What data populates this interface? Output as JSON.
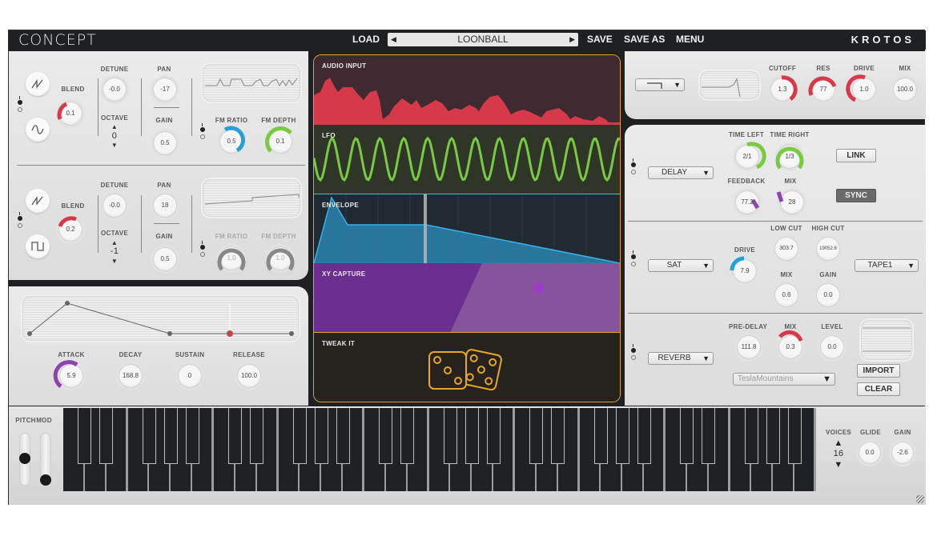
{
  "header": {
    "logo": "CONCEPT",
    "load": "LOAD",
    "preset": "LOONBALL",
    "save": "SAVE",
    "save_as": "SAVE AS",
    "menu": "MENU",
    "brand": "KROTOS",
    "prev_icon": "◀",
    "next_icon": "▶"
  },
  "osc1": {
    "blend_label": "BLEND",
    "blend": "0.1",
    "detune_label": "DETUNE",
    "detune": "-0.0",
    "octave_label": "OCTAVE",
    "octave": "0",
    "pan_label": "PAN",
    "pan": "-17",
    "gain_label": "GAIN",
    "gain": "0.5",
    "fm_ratio_label": "FM RATIO",
    "fm_ratio": "0.5",
    "fm_depth_label": "FM DEPTH",
    "fm_depth": "0.1",
    "wave_top": "saw",
    "wave_bottom": "sine"
  },
  "osc2": {
    "blend_label": "BLEND",
    "blend": "0.2",
    "detune_label": "DETUNE",
    "detune": "-0.0",
    "octave_label": "OCTAVE",
    "octave": "-1",
    "pan_label": "PAN",
    "pan": "18",
    "gain_label": "GAIN",
    "gain": "0.5",
    "fm_ratio_label": "FM RATIO",
    "fm_ratio": "1.0",
    "fm_depth_label": "FM DEPTH",
    "fm_depth": "1.0",
    "wave_top": "saw",
    "wave_bottom": "square"
  },
  "env": {
    "attack_label": "ATTACK",
    "attack": "5.9",
    "decay_label": "DECAY",
    "decay": "168.8",
    "sustain_label": "SUSTAIN",
    "sustain": "0",
    "release_label": "RELEASE",
    "release": "100.0"
  },
  "mods": {
    "audio_input": "AUDIO INPUT",
    "lfo": "LFO",
    "envelope": "ENVELOPE",
    "xy_capture": "XY CAPTURE",
    "tweak_it": "TWEAK IT",
    "colors": {
      "audio": "#d6394a",
      "lfo": "#7ac943",
      "env": "#2a9fd6",
      "xy": "#6b2f8f",
      "tweak": "#e8a52a"
    }
  },
  "filter": {
    "type_icon": "lowpass-shape",
    "cutoff_label": "CUTOFF",
    "cutoff": "1.3",
    "res_label": "RES",
    "res": "77",
    "drive_label": "DRIVE",
    "drive": "1.0",
    "mix_label": "MIX",
    "mix": "100.0"
  },
  "delay": {
    "type": "DELAY",
    "time_left_label": "TIME LEFT",
    "time_left": "2/1",
    "time_right_label": "TIME RIGHT",
    "time_right": "1/3",
    "feedback_label": "FEEDBACK",
    "feedback": "77.2",
    "mix_label": "MIX",
    "mix": "28",
    "link": "LINK",
    "sync": "SYNC"
  },
  "sat": {
    "type": "SAT",
    "drive_label": "DRIVE",
    "drive": "7.9",
    "low_cut_label": "LOW CUT",
    "low_cut": "303.7",
    "high_cut_label": "HIGH CUT",
    "high_cut": "19052.6",
    "mix_label": "MIX",
    "mix": "0.6",
    "gain_label": "GAIN",
    "gain": "0.0",
    "model": "TAPE1"
  },
  "reverb": {
    "type": "REVERB",
    "pre_delay_label": "PRE-DELAY",
    "pre_delay": "111.8",
    "mix_label": "MIX",
    "mix": "0.3",
    "level_label": "LEVEL",
    "level": "0.0",
    "ir": "TeslaMountains",
    "import": "IMPORT",
    "clear": "CLEAR"
  },
  "keyboard": {
    "pitch_label": "PITCH",
    "mod_label": "MOD",
    "octaves": 5,
    "voices_label": "VOICES",
    "voices": "16",
    "glide_label": "GLIDE",
    "glide": "0.0",
    "gain_label": "GAIN",
    "gain": "-2.6"
  },
  "dropdown_arrow": "▼",
  "up_arrow": "▲",
  "down_arrow": "▼"
}
